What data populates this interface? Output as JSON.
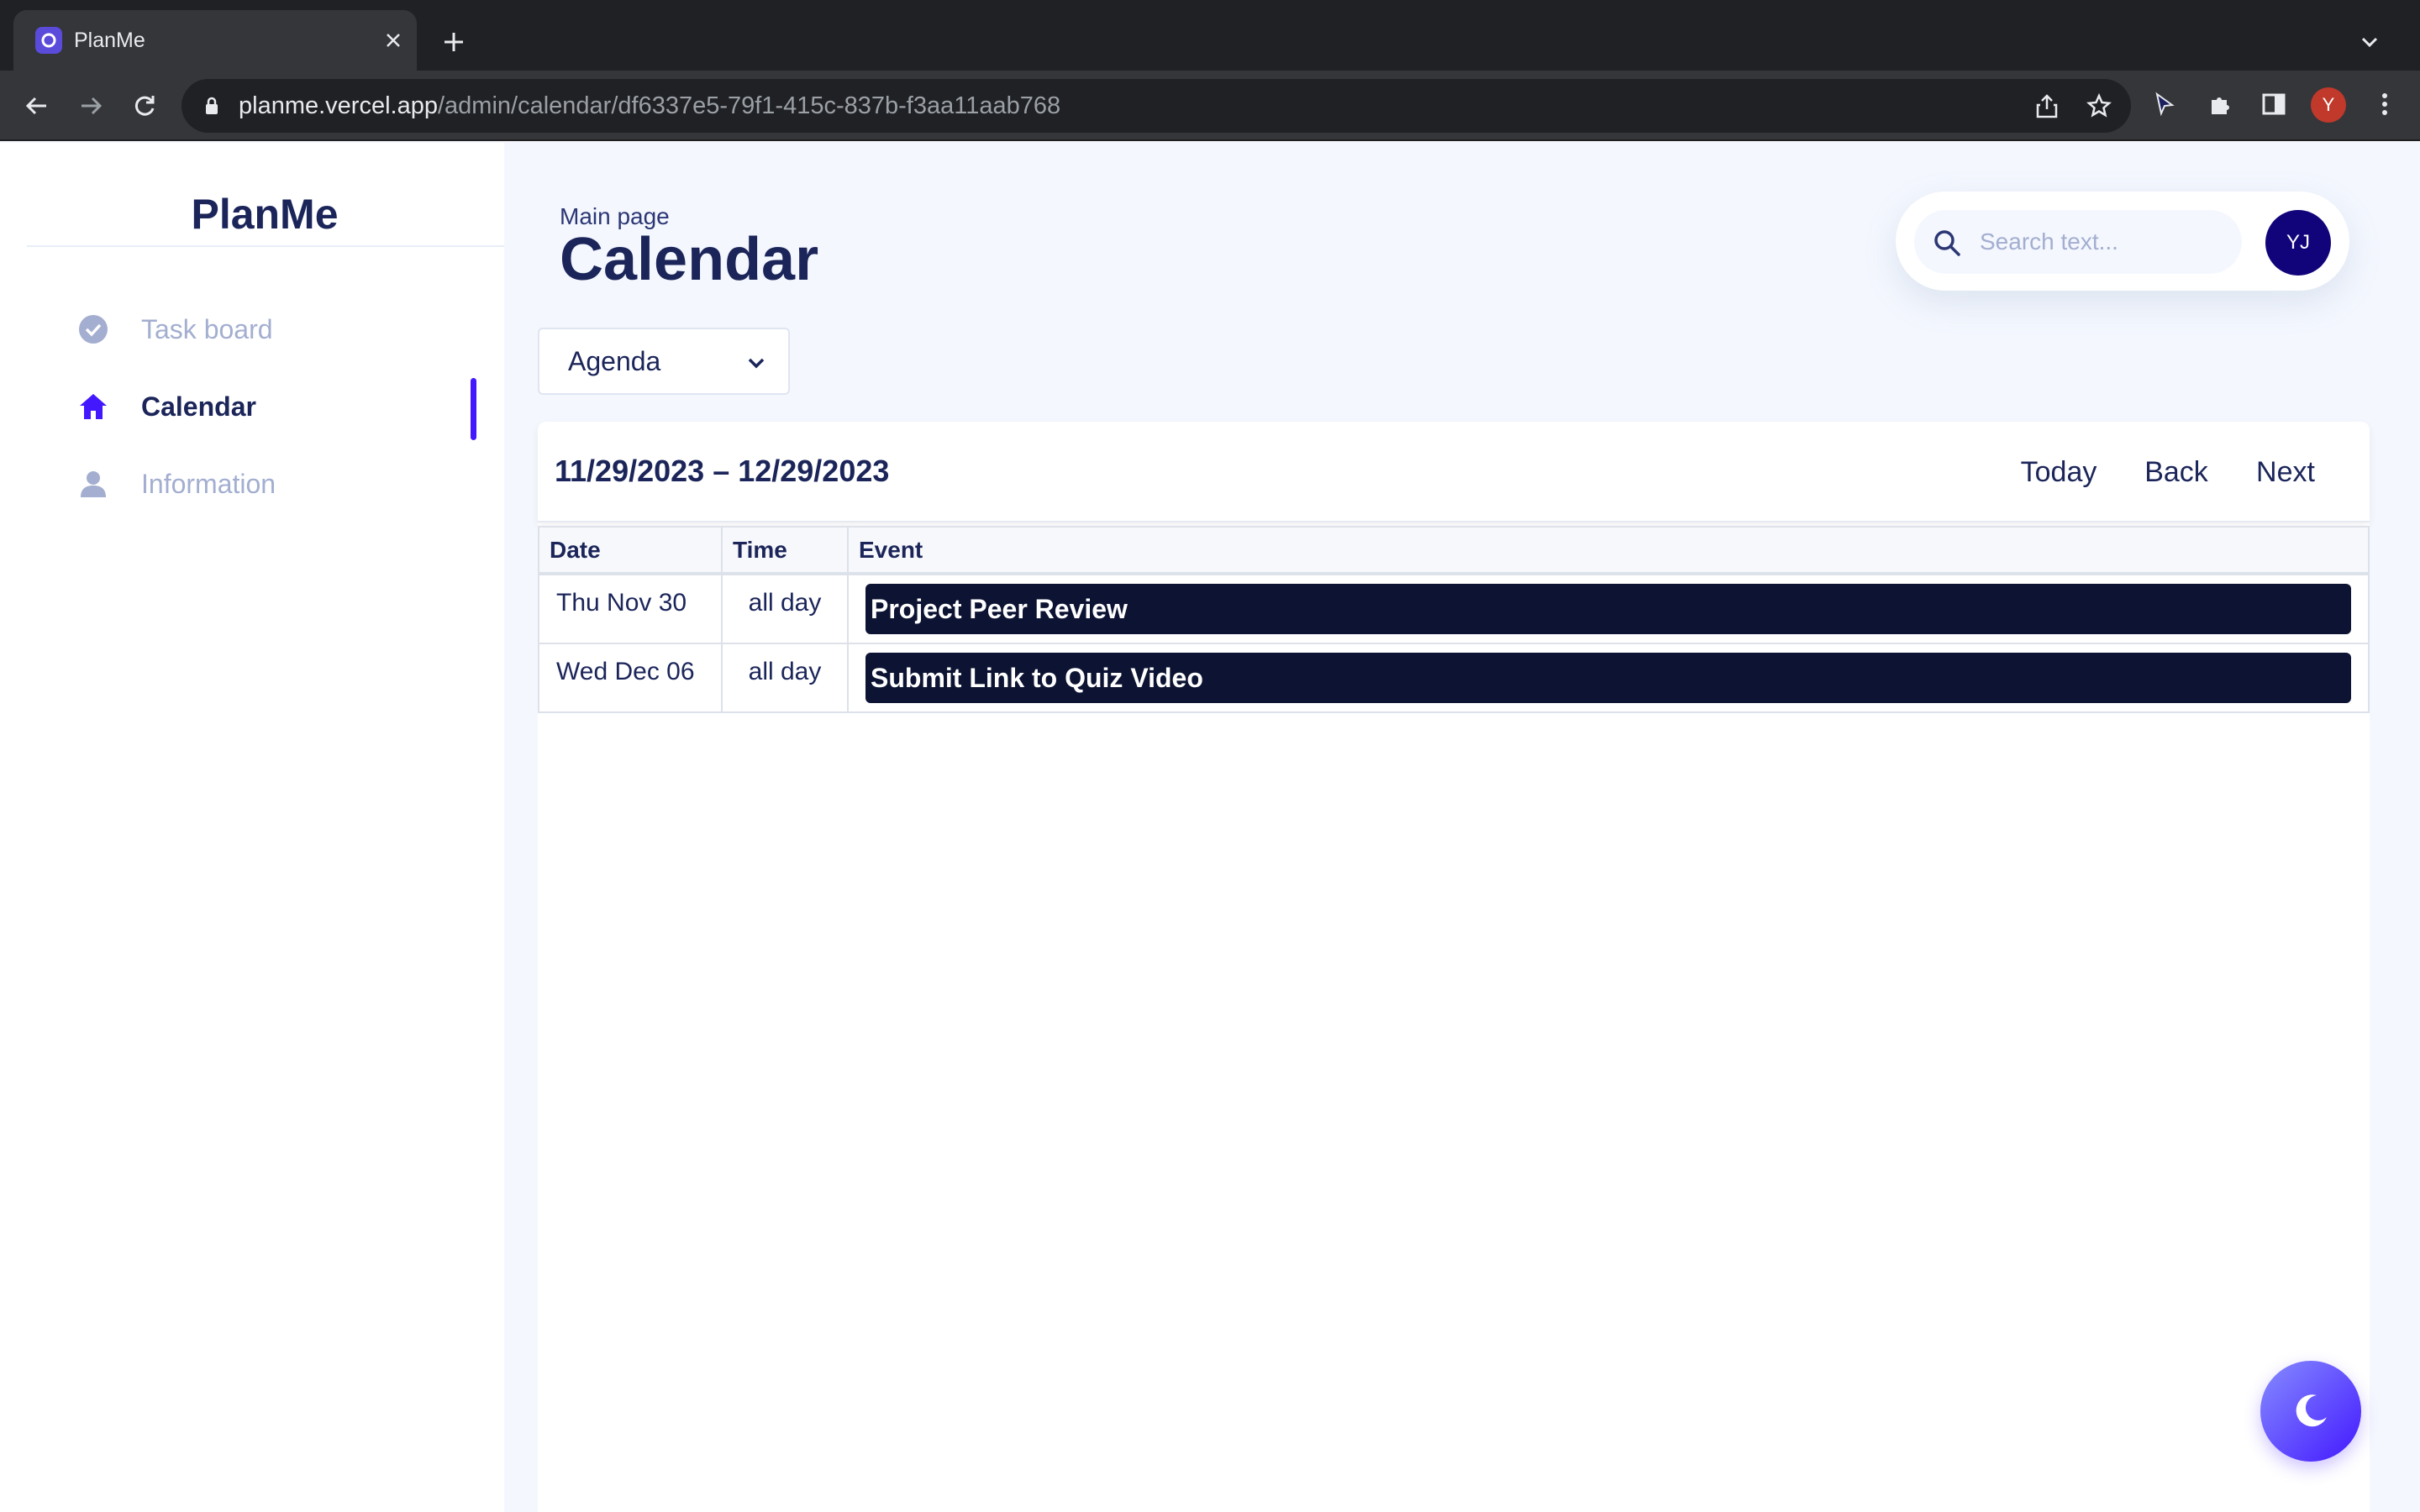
{
  "browser": {
    "tab_title": "PlanMe",
    "url_host": "planme.vercel.app",
    "url_path": "/admin/calendar/df6337e5-79f1-415c-837b-f3aa11aab768",
    "profile_initial": "Y"
  },
  "sidebar": {
    "brand": "PlanMe",
    "items": [
      {
        "label": "Task board",
        "icon": "check-circle-icon",
        "active": false
      },
      {
        "label": "Calendar",
        "icon": "home-icon",
        "active": true
      },
      {
        "label": "Information",
        "icon": "person-icon",
        "active": false
      }
    ]
  },
  "header": {
    "breadcrumb": "Main page",
    "title": "Calendar"
  },
  "search": {
    "placeholder": "Search text...",
    "avatar_initials": "YJ"
  },
  "view_select": {
    "selected": "Agenda"
  },
  "calendar": {
    "range": "11/29/2023 – 12/29/2023",
    "buttons": {
      "today": "Today",
      "back": "Back",
      "next": "Next"
    },
    "columns": [
      "Date",
      "Time",
      "Event"
    ],
    "rows": [
      {
        "date": "Thu Nov 30",
        "time": "all day",
        "event": "Project Peer Review"
      },
      {
        "date": "Wed Dec 06",
        "time": "all day",
        "event": "Submit Link to Quiz Video"
      }
    ]
  },
  "colors": {
    "accent": "#4318ff",
    "brand_text": "#1b2559",
    "event_chip": "#0d1433",
    "page_bg": "#f4f7fe"
  }
}
